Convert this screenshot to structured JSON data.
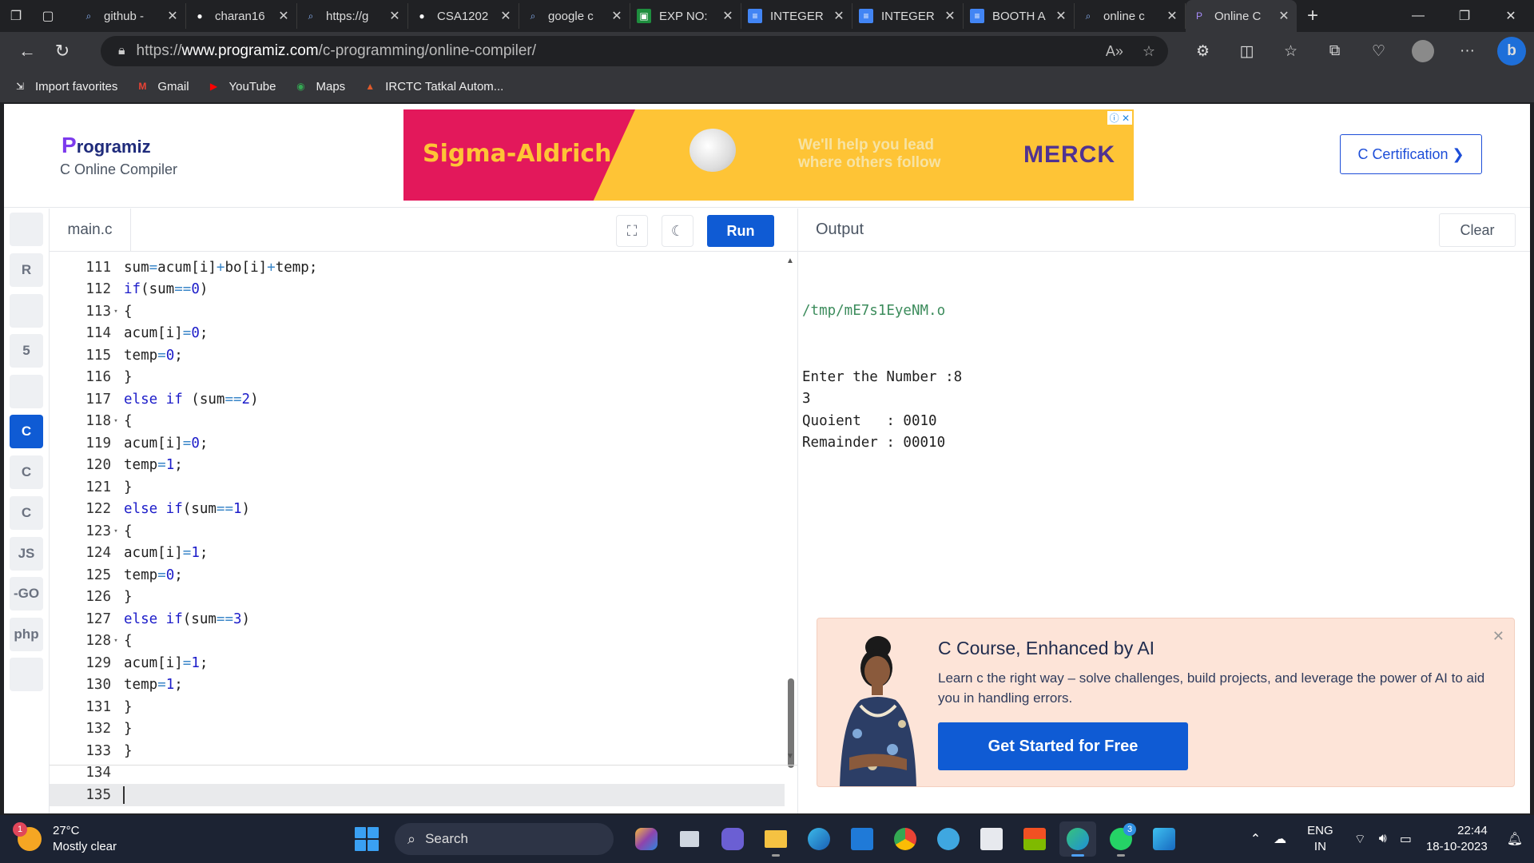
{
  "browser": {
    "tabs": [
      {
        "title": "github -",
        "icon": "search-icon",
        "active": false
      },
      {
        "title": "charan16",
        "icon": "github-icon",
        "active": false
      },
      {
        "title": "https://g",
        "icon": "search-icon",
        "active": false
      },
      {
        "title": "CSA1202",
        "icon": "github-icon",
        "active": false
      },
      {
        "title": "google c",
        "icon": "search-icon",
        "active": false
      },
      {
        "title": "EXP NO:",
        "icon": "classroom-icon",
        "active": false
      },
      {
        "title": "INTEGER",
        "icon": "docs-icon",
        "active": false
      },
      {
        "title": "INTEGER",
        "icon": "docs-icon",
        "active": false
      },
      {
        "title": "BOOTH A",
        "icon": "docs-icon",
        "active": false
      },
      {
        "title": "online c",
        "icon": "search-icon",
        "active": false
      },
      {
        "title": "Online C",
        "icon": "programiz-icon",
        "active": true
      }
    ],
    "url_prefix": "https://",
    "url_domain": "www.programiz.com",
    "url_path": "/c-programming/online-compiler/",
    "favorites": [
      {
        "label": "Import favorites",
        "icon": "import-icon"
      },
      {
        "label": "Gmail",
        "icon": "gmail-icon"
      },
      {
        "label": "YouTube",
        "icon": "youtube-icon"
      },
      {
        "label": "Maps",
        "icon": "maps-icon"
      },
      {
        "label": "IRCTC Tatkal Autom...",
        "icon": "irctc-icon"
      }
    ]
  },
  "site": {
    "logo_text": "rogramiz",
    "logo_initial": "P",
    "subtitle": "C Online Compiler",
    "certification_button": "C Certification ❯",
    "ad": {
      "brand": "Sigma-Aldrich.",
      "tagline_1": "We'll help you lead",
      "tagline_2": "where others follow",
      "merck": "MERCK",
      "ad_marker": "ⓘ ✕"
    }
  },
  "sidebar": {
    "items": [
      {
        "name": "python",
        "label": "",
        "active": false
      },
      {
        "name": "r",
        "label": "R",
        "active": false
      },
      {
        "name": "sql",
        "label": "",
        "active": false
      },
      {
        "name": "html",
        "label": "5",
        "active": false
      },
      {
        "name": "java",
        "label": "",
        "active": false
      },
      {
        "name": "c",
        "label": "C",
        "active": true
      },
      {
        "name": "cpp",
        "label": "C",
        "active": false
      },
      {
        "name": "csharp",
        "label": "C",
        "active": false
      },
      {
        "name": "js",
        "label": "JS",
        "active": false
      },
      {
        "name": "go",
        "label": "-GO",
        "active": false
      },
      {
        "name": "php",
        "label": "php",
        "active": false
      },
      {
        "name": "swift",
        "label": "",
        "active": false
      }
    ]
  },
  "editor": {
    "file_tab": "main.c",
    "run_label": "Run",
    "lines": [
      {
        "n": "111",
        "fold": "",
        "tokens": [
          [
            "",
            "sum"
          ],
          [
            "op",
            "="
          ],
          [
            "",
            "acum[i]"
          ],
          [
            "op",
            "+"
          ],
          [
            "",
            "bo[i]"
          ],
          [
            "op",
            "+"
          ],
          [
            "",
            "temp;"
          ]
        ]
      },
      {
        "n": "112",
        "fold": "",
        "tokens": [
          [
            "kw",
            "if"
          ],
          [
            "",
            "(sum"
          ],
          [
            "op",
            "=="
          ],
          [
            "kw",
            "0"
          ],
          [
            "",
            ")"
          ]
        ]
      },
      {
        "n": "113",
        "fold": "▾",
        "tokens": [
          [
            "",
            "{"
          ]
        ]
      },
      {
        "n": "114",
        "fold": "",
        "tokens": [
          [
            "",
            "acum[i]"
          ],
          [
            "op",
            "="
          ],
          [
            "kw",
            "0"
          ],
          [
            "",
            ";"
          ]
        ]
      },
      {
        "n": "115",
        "fold": "",
        "tokens": [
          [
            "",
            "temp"
          ],
          [
            "op",
            "="
          ],
          [
            "kw",
            "0"
          ],
          [
            "",
            ";"
          ]
        ]
      },
      {
        "n": "116",
        "fold": "",
        "tokens": [
          [
            "",
            "}"
          ]
        ]
      },
      {
        "n": "117",
        "fold": "",
        "tokens": [
          [
            "kw",
            "else if"
          ],
          [
            "",
            " (sum"
          ],
          [
            "op",
            "=="
          ],
          [
            "kw",
            "2"
          ],
          [
            "",
            ")"
          ]
        ]
      },
      {
        "n": "118",
        "fold": "▾",
        "tokens": [
          [
            "",
            "{"
          ]
        ]
      },
      {
        "n": "119",
        "fold": "",
        "tokens": [
          [
            "",
            "acum[i]"
          ],
          [
            "op",
            "="
          ],
          [
            "kw",
            "0"
          ],
          [
            "",
            ";"
          ]
        ]
      },
      {
        "n": "120",
        "fold": "",
        "tokens": [
          [
            "",
            "temp"
          ],
          [
            "op",
            "="
          ],
          [
            "kw",
            "1"
          ],
          [
            "",
            ";"
          ]
        ]
      },
      {
        "n": "121",
        "fold": "",
        "tokens": [
          [
            "",
            "}"
          ]
        ]
      },
      {
        "n": "122",
        "fold": "",
        "tokens": [
          [
            "kw",
            "else if"
          ],
          [
            "",
            "(sum"
          ],
          [
            "op",
            "=="
          ],
          [
            "kw",
            "1"
          ],
          [
            "",
            ")"
          ]
        ]
      },
      {
        "n": "123",
        "fold": "▾",
        "tokens": [
          [
            "",
            "{"
          ]
        ]
      },
      {
        "n": "124",
        "fold": "",
        "tokens": [
          [
            "",
            "acum[i]"
          ],
          [
            "op",
            "="
          ],
          [
            "kw",
            "1"
          ],
          [
            "",
            ";"
          ]
        ]
      },
      {
        "n": "125",
        "fold": "",
        "tokens": [
          [
            "",
            "temp"
          ],
          [
            "op",
            "="
          ],
          [
            "kw",
            "0"
          ],
          [
            "",
            ";"
          ]
        ]
      },
      {
        "n": "126",
        "fold": "",
        "tokens": [
          [
            "",
            "}"
          ]
        ]
      },
      {
        "n": "127",
        "fold": "",
        "tokens": [
          [
            "kw",
            "else if"
          ],
          [
            "",
            "(sum"
          ],
          [
            "op",
            "=="
          ],
          [
            "kw",
            "3"
          ],
          [
            "",
            ")"
          ]
        ]
      },
      {
        "n": "128",
        "fold": "▾",
        "tokens": [
          [
            "",
            "{"
          ]
        ]
      },
      {
        "n": "129",
        "fold": "",
        "tokens": [
          [
            "",
            "acum[i]"
          ],
          [
            "op",
            "="
          ],
          [
            "kw",
            "1"
          ],
          [
            "",
            ";"
          ]
        ]
      },
      {
        "n": "130",
        "fold": "",
        "tokens": [
          [
            "",
            "temp"
          ],
          [
            "op",
            "="
          ],
          [
            "kw",
            "1"
          ],
          [
            "",
            ";"
          ]
        ]
      },
      {
        "n": "131",
        "fold": "",
        "tokens": [
          [
            "",
            "}"
          ]
        ]
      },
      {
        "n": "132",
        "fold": "",
        "tokens": [
          [
            "",
            "}"
          ]
        ]
      },
      {
        "n": "133",
        "fold": "",
        "tokens": [
          [
            "",
            "}"
          ]
        ]
      },
      {
        "n": "134",
        "fold": "",
        "tokens": []
      },
      {
        "n": "135",
        "fold": "",
        "tokens": [],
        "current": true
      }
    ]
  },
  "output": {
    "title": "Output",
    "clear_label": "Clear",
    "path_line": "/tmp/mE7s1EyeNM.o",
    "lines": [
      "Enter the Number :8",
      "3",
      "Quoient   : 0010",
      "Remainder : 00010"
    ]
  },
  "promo": {
    "title": "C Course, Enhanced by AI",
    "body": "Learn c the right way – solve challenges, build projects, and leverage the power of AI to aid you in handling errors.",
    "cta": "Get Started for Free"
  },
  "taskbar": {
    "weather_badge": "1",
    "temperature": "27°C",
    "condition": "Mostly clear",
    "search_label": "Search",
    "language_1": "ENG",
    "language_2": "IN",
    "time": "22:44",
    "date": "18-10-2023",
    "whatsapp_badge": "3"
  }
}
